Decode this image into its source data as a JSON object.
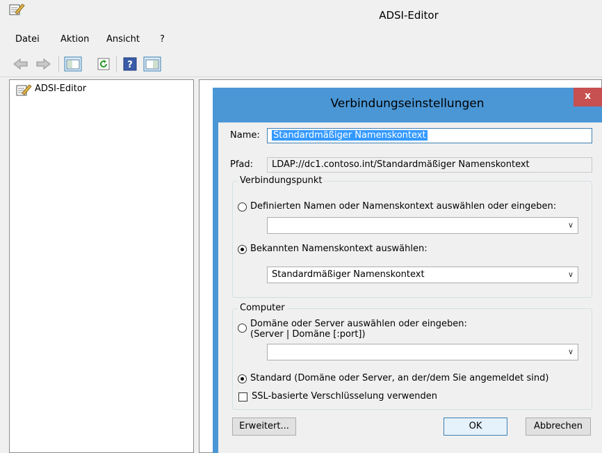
{
  "window": {
    "title": "ADSI-Editor"
  },
  "menu": [
    "Datei",
    "Aktion",
    "Ansicht",
    "?"
  ],
  "tree": {
    "root_label": "ADSI-Editor"
  },
  "dialog": {
    "title": "Verbindungseinstellungen",
    "close_glyph": "x",
    "name_label": "Name:",
    "name_value": "Standardmäßiger Namenskontext",
    "path_label": "Pfad:",
    "path_value": "LDAP://dc1.contoso.int/Standardmäßiger Namenskontext",
    "connection_point": {
      "title": "Verbindungspunkt",
      "option_defined": "Definierten Namen oder Namenskontext auswählen oder eingeben:",
      "defined_value": "",
      "option_known": "Bekannten Namenskontext auswählen:",
      "known_value": "Standardmäßiger Namenskontext",
      "selected": "known"
    },
    "computer": {
      "title": "Computer",
      "option_select_line1": "Domäne oder Server auswählen oder eingeben:",
      "option_select_line2": "(Server | Domäne [:port])",
      "select_value": "",
      "option_default": "Standard (Domäne oder Server, an der/dem Sie angemeldet sind)",
      "selected": "default",
      "ssl_label": "SSL-basierte Verschlüsselung verwenden",
      "ssl_checked": false
    },
    "buttons": {
      "advanced": "Erweitert...",
      "ok": "OK",
      "cancel": "Abbrechen"
    }
  },
  "dropdown_glyph": "∨"
}
